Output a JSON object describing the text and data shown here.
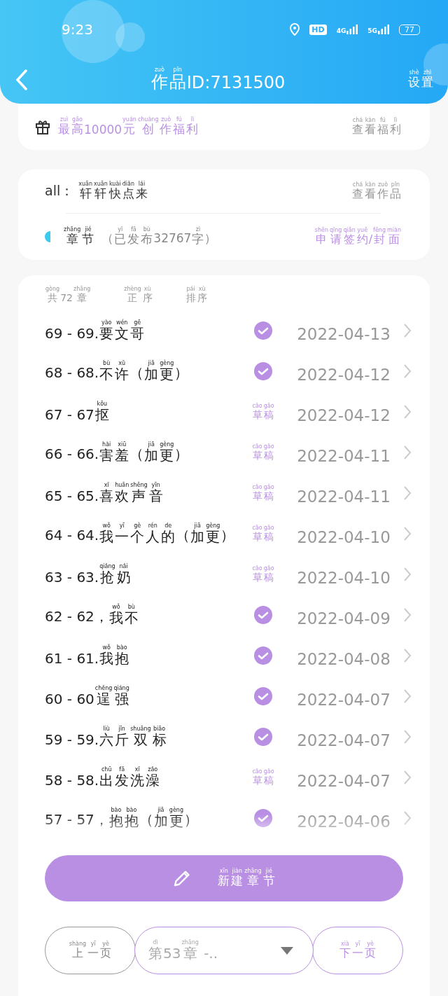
{
  "status_bar": {
    "time": "9:23",
    "hd": "HD",
    "networks": [
      "4G",
      "5G"
    ],
    "battery": "77"
  },
  "header": {
    "title": [
      [
        "zuò",
        "作"
      ],
      [
        "pǐn",
        "品"
      ],
      "ID:7131500"
    ],
    "settings": [
      [
        "shè",
        "设"
      ],
      [
        "zhì",
        "置"
      ]
    ]
  },
  "bonus_card": {
    "text": [
      [
        "zuì",
        "最"
      ],
      [
        "gāo",
        "高"
      ],
      "10000",
      [
        "yuán",
        "元"
      ],
      [
        "chuàng",
        "创"
      ],
      [
        "zuò",
        "作"
      ],
      [
        "fú",
        "福"
      ],
      [
        "lì",
        "利"
      ]
    ],
    "link": [
      [
        "chá",
        "查"
      ],
      [
        "kàn",
        "看"
      ],
      [
        "fú",
        "福"
      ],
      [
        "lì",
        "利"
      ]
    ]
  },
  "work_card": {
    "author": "all：",
    "work_title": [
      [
        "xuān",
        "轩"
      ],
      [
        "xuān",
        "轩"
      ],
      [
        "kuài",
        "快"
      ],
      [
        "diǎn",
        "点"
      ],
      [
        "lái",
        "来"
      ]
    ],
    "view_link": [
      [
        "chá",
        "查"
      ],
      [
        "kàn",
        "看"
      ],
      [
        "zuò",
        "作"
      ],
      [
        "pǐn",
        "品"
      ]
    ],
    "chapters_label": [
      [
        "zhāng",
        "章"
      ],
      [
        "jié",
        "节"
      ]
    ],
    "chapters_stats": [
      "（",
      [
        "yǐ",
        "已"
      ],
      [
        "fā",
        "发"
      ],
      [
        "bù",
        "布"
      ],
      "32767",
      [
        "zì",
        "字"
      ],
      "）"
    ],
    "apply_link": [
      [
        "shēn",
        "申"
      ],
      [
        "qǐng",
        "请"
      ],
      [
        "qiān",
        "签"
      ],
      [
        "yuē",
        "约"
      ],
      "/",
      [
        "fēng",
        "封"
      ],
      [
        "miàn",
        "面"
      ]
    ]
  },
  "list_header": [
    [
      [
        "gòng",
        "共"
      ],
      "72",
      [
        "zhāng",
        "章"
      ]
    ],
    [
      [
        "zhèng",
        "正"
      ],
      [
        "xù",
        "序"
      ]
    ],
    [
      [
        "pái",
        "排"
      ],
      [
        "xù",
        "序"
      ]
    ]
  ],
  "chapters": [
    {
      "title": [
        "69 - 69.",
        [
          "yào",
          "要"
        ],
        [
          "wén",
          "文"
        ],
        [
          "gē",
          "哥"
        ]
      ],
      "published": true,
      "date": "2022-04-13"
    },
    {
      "title": [
        "68 - 68.",
        [
          "bù",
          "不"
        ],
        [
          "xǔ",
          "许"
        ],
        "（",
        [
          "jiā",
          "加"
        ],
        [
          "gèng",
          "更"
        ],
        "）"
      ],
      "published": true,
      "date": "2022-04-12"
    },
    {
      "title": [
        "67 - 67",
        [
          "kōu",
          "抠"
        ]
      ],
      "published": false,
      "draft_label": [
        [
          "cǎo",
          "草"
        ],
        [
          "gǎo",
          "稿"
        ]
      ],
      "date": "2022-04-12"
    },
    {
      "title": [
        "66 - 66.",
        [
          "hài",
          "害"
        ],
        [
          "xiū",
          "羞"
        ],
        "（",
        [
          "jiā",
          "加"
        ],
        [
          "gèng",
          "更"
        ],
        "）"
      ],
      "published": false,
      "draft_label": [
        [
          "cǎo",
          "草"
        ],
        [
          "gǎo",
          "稿"
        ]
      ],
      "date": "2022-04-11"
    },
    {
      "title": [
        "65 - 65.",
        [
          "xǐ",
          "喜"
        ],
        [
          "huān",
          "欢"
        ],
        [
          "shēng",
          "声"
        ],
        [
          "yīn",
          "音"
        ]
      ],
      "published": false,
      "draft_label": [
        [
          "cǎo",
          "草"
        ],
        [
          "gǎo",
          "稿"
        ]
      ],
      "date": "2022-04-11"
    },
    {
      "title": [
        "64 - 64.",
        [
          "wǒ",
          "我"
        ],
        [
          "yī",
          "一"
        ],
        [
          "gè",
          "个"
        ],
        [
          "rén",
          "人"
        ],
        [
          "de",
          "的"
        ],
        "（",
        [
          "jiā",
          "加"
        ],
        [
          "gèng",
          "更"
        ],
        "）"
      ],
      "published": false,
      "draft_label": [
        [
          "cǎo",
          "草"
        ],
        [
          "gǎo",
          "稿"
        ]
      ],
      "date": "2022-04-10"
    },
    {
      "title": [
        "63 - 63.",
        [
          "qiǎng",
          "抢"
        ],
        [
          "nǎi",
          "奶"
        ]
      ],
      "published": false,
      "draft_label": [
        [
          "cǎo",
          "草"
        ],
        [
          "gǎo",
          "稿"
        ]
      ],
      "date": "2022-04-10"
    },
    {
      "title": [
        "62 - 62，",
        [
          "wǒ",
          "我"
        ],
        [
          "bù",
          "不"
        ]
      ],
      "published": true,
      "date": "2022-04-09"
    },
    {
      "title": [
        "61 - 61.",
        [
          "wǒ",
          "我"
        ],
        [
          "bào",
          "抱"
        ]
      ],
      "published": true,
      "date": "2022-04-08"
    },
    {
      "title": [
        "60 - 60",
        [
          "chěng",
          "逞"
        ],
        [
          "qiáng",
          "强"
        ]
      ],
      "published": true,
      "date": "2022-04-07"
    },
    {
      "title": [
        "59 - 59.",
        [
          "liù",
          "六"
        ],
        [
          "jīn",
          "斤"
        ],
        [
          "shuāng",
          "双"
        ],
        [
          "biāo",
          "标"
        ]
      ],
      "published": true,
      "date": "2022-04-07"
    },
    {
      "title": [
        "58 - 58.",
        [
          "chū",
          "出"
        ],
        [
          "fā",
          "发"
        ],
        [
          "xǐ",
          "洗"
        ],
        [
          "zǎo",
          "澡"
        ]
      ],
      "published": false,
      "draft_label": [
        [
          "cǎo",
          "草"
        ],
        [
          "gǎo",
          "稿"
        ]
      ],
      "date": "2022-04-07"
    },
    {
      "title": [
        "57 - 57，",
        [
          "bào",
          "抱"
        ],
        [
          "bào",
          "抱"
        ],
        "（",
        [
          "jiā",
          "加"
        ],
        [
          "gèng",
          "更"
        ],
        "）"
      ],
      "published": true,
      "date": "2022-04-06"
    }
  ],
  "new_chapter_button": [
    [
      "xīn",
      "新"
    ],
    [
      "jiàn",
      "建"
    ],
    [
      "zhāng",
      "章"
    ],
    [
      "jié",
      "节"
    ]
  ],
  "pager": {
    "previous": [
      [
        "shàng",
        "上"
      ],
      [
        "yī",
        "一"
      ],
      [
        "yè",
        "页"
      ]
    ],
    "select": [
      [
        "dì",
        "第"
      ],
      "53",
      [
        "zhāng",
        "章"
      ],
      " -.."
    ],
    "next": [
      [
        "xià",
        "下"
      ],
      [
        "yī",
        "一"
      ],
      [
        "yè",
        "页"
      ]
    ]
  }
}
